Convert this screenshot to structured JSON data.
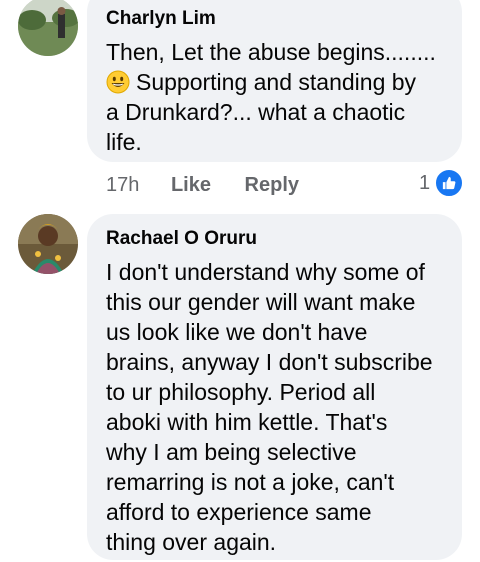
{
  "comments": [
    {
      "author": "Charlyn Lim",
      "lines": [
        "Then, Let the abuse begins........",
        "Supporting and standing by",
        "a Drunkard?... what a chaotic",
        "life."
      ],
      "emoji_icon": "grinning-face-emoji",
      "time": "17h",
      "like_label": "Like",
      "reply_label": "Reply",
      "reaction_count": "1",
      "reaction_icon": "like-thumb-icon"
    },
    {
      "author": "Rachael O Oruru",
      "lines": [
        "I don't understand why some of",
        "this our gender will want make",
        "us look like we don't have",
        "brains, anyway I don't subscribe",
        "to ur philosophy. Period all",
        "aboki with him kettle. That's",
        "why I am being selective",
        "remarring is not a joke, can't",
        "afford to experience same",
        "thing over again."
      ]
    }
  ],
  "colors": {
    "bubble": "#f0f2f5",
    "meta_text": "#65676b",
    "like_blue": "#1877f2"
  }
}
